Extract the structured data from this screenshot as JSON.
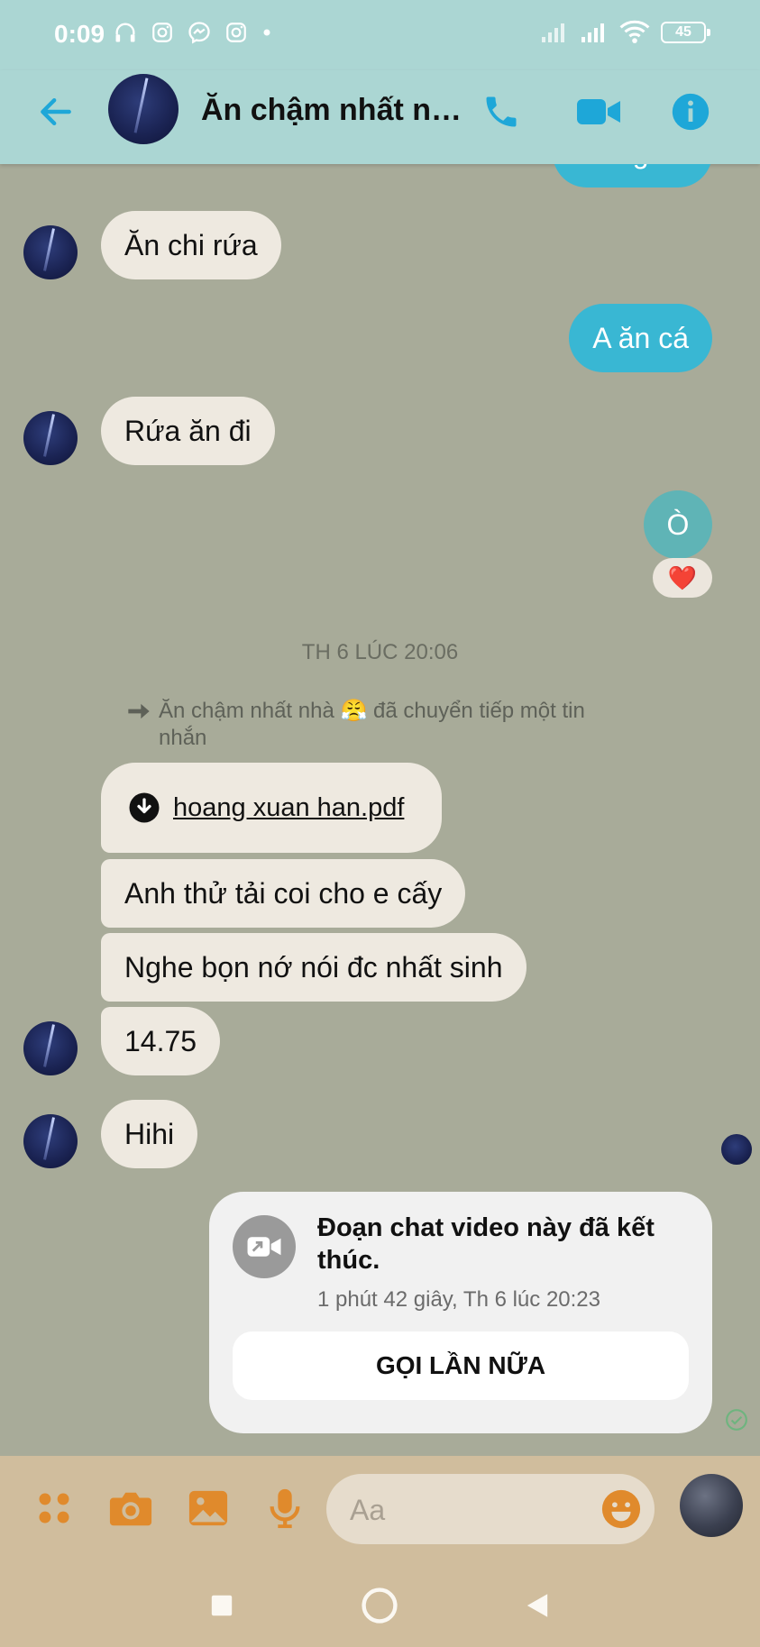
{
  "status_bar": {
    "time": "0:09",
    "battery": "45",
    "left_icons": [
      "headphones-icon",
      "instagram-icon",
      "messenger-icon",
      "instagram-icon",
      "dot-icon"
    ],
    "right_icons": [
      "signal-icon",
      "signal-icon",
      "wifi-icon",
      "battery-icon"
    ]
  },
  "header": {
    "title": "Ăn chậm nhất nhà 😤",
    "back_icon": "arrow-left-icon",
    "call_icon": "phone-icon",
    "video_icon": "video-icon",
    "info_icon": "info-icon",
    "accent_color": "#1ea7d8"
  },
  "messages": {
    "partial_out": "Đừng ăn",
    "m1": "Ăn chi rứa",
    "m2": "A ăn cá",
    "m3": "Rứa ăn đi",
    "m4": "Ò",
    "m4_reaction": "❤️",
    "timestamp": "TH 6 LÚC 20:06",
    "forward_note": "Ăn chậm nhất nhà 😤 đã chuyển tiếp một tin nhắn",
    "file_name": "hoang xuan han.pdf",
    "m5": "Anh thử tải coi cho e cấy",
    "m6": "Nghe bọn nớ nói đc nhất sinh",
    "m7": "14.75",
    "m8": "Hihi"
  },
  "call_card": {
    "title": "Đoạn chat video này đã kết thúc.",
    "subtitle": "1 phút 42 giây, Th 6 lúc 20:23",
    "button": "GỌI LẦN NỮA"
  },
  "composer": {
    "placeholder": "Aa",
    "icons": [
      "grid-icon",
      "camera-icon",
      "image-icon",
      "mic-icon",
      "emoji-icon"
    ],
    "accent_color": "#e08a2c"
  },
  "colors": {
    "chat_bg": "#a8ab99",
    "incoming_bubble": "#eee9e0",
    "outgoing_bubble": "#39b7d3",
    "header_bg": "#abd6d3",
    "composer_bg": "#d0bd9d"
  }
}
